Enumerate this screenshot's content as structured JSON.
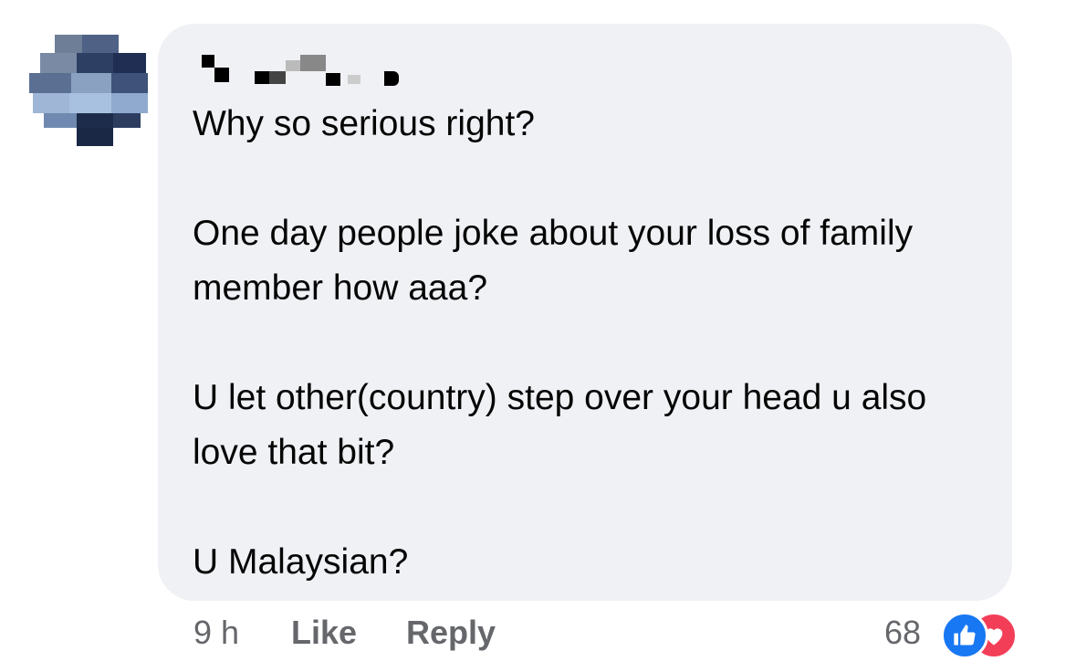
{
  "comment": {
    "author_name": "",
    "paragraphs": [
      "Why so serious right?",
      "One day people joke about your loss of family member how aaa?",
      "U let other(country) step over your head u also love that bit?",
      "U Malaysian?"
    ]
  },
  "meta": {
    "timestamp": "9 h",
    "like_label": "Like",
    "reply_label": "Reply"
  },
  "reactions": {
    "count": "68",
    "types": [
      "like-icon",
      "love-icon"
    ],
    "colors": {
      "like": "#1877f2",
      "love": "#f33e58"
    }
  },
  "colors": {
    "bubble": "#f0f1f5",
    "text": "#050505",
    "meta_text": "#65676b"
  }
}
